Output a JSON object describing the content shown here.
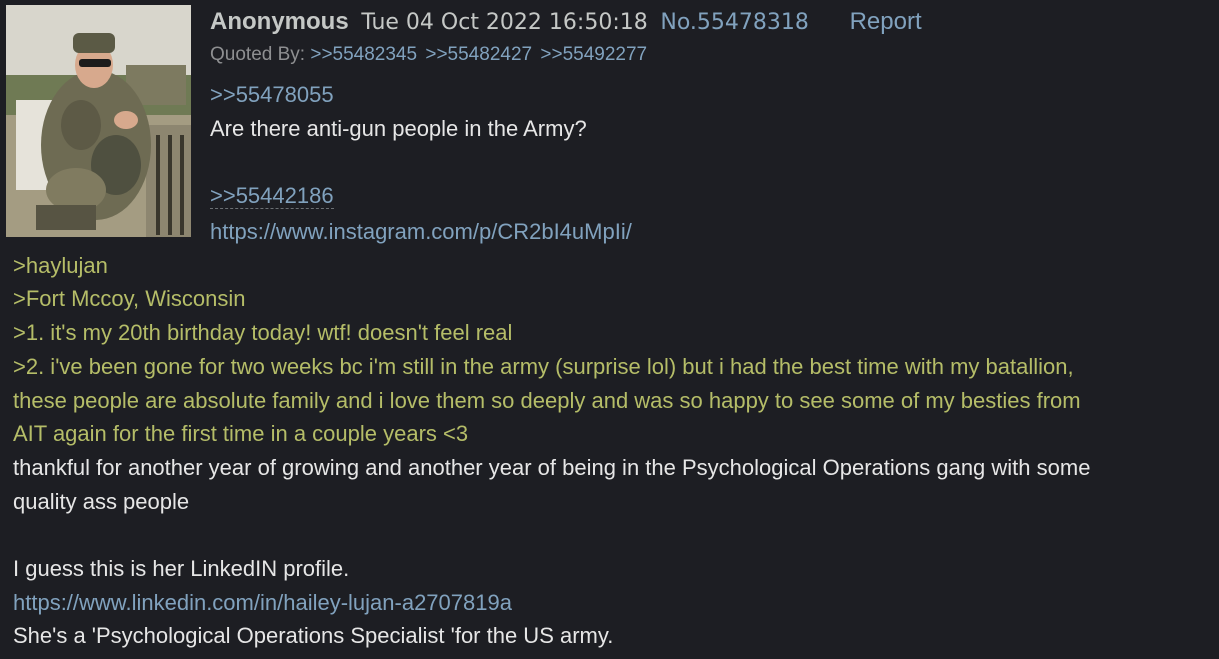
{
  "post": {
    "name": "Anonymous",
    "datetime": "Tue 04 Oct 2022 16:50:18",
    "number": "No.55478318",
    "report": "Report",
    "quoted_by_label": "Quoted By:",
    "quoted_by": [
      ">>55482345",
      ">>55482427",
      ">>55492277"
    ],
    "body": {
      "reply_link_1": ">>55478055",
      "line_question": "Are there anti-gun people in the Army?",
      "reply_link_2": ">>55442186",
      "instagram_url": "https://www.instagram.com/p/CR2bI4uMpIi/",
      "green_1": ">haylujan",
      "green_2": ">Fort Mccoy, Wisconsin",
      "green_3": ">1. it's my 20th birthday today! wtf! doesn't feel real",
      "green_4a": ">2. i've been gone for two weeks bc i'm still in the army (surprise lol) but i had the best time with my batallion,",
      "green_4b": "these people are absolute family and i love them so deeply and was so happy to see some of my besties from",
      "green_4c": "AIT again for the first time in a couple years <3",
      "plain_1a": "thankful for another year of growing and another year of being in the Psychological Operations gang with some",
      "plain_1b": "quality ass people",
      "plain_2": "I guess this is her LinkedIN profile.",
      "linkedin_url": "https://www.linkedin.com/in/hailey-lujan-a2707819a",
      "plain_3": "She's a 'Psychological Operations Specialist 'for the US army."
    }
  }
}
